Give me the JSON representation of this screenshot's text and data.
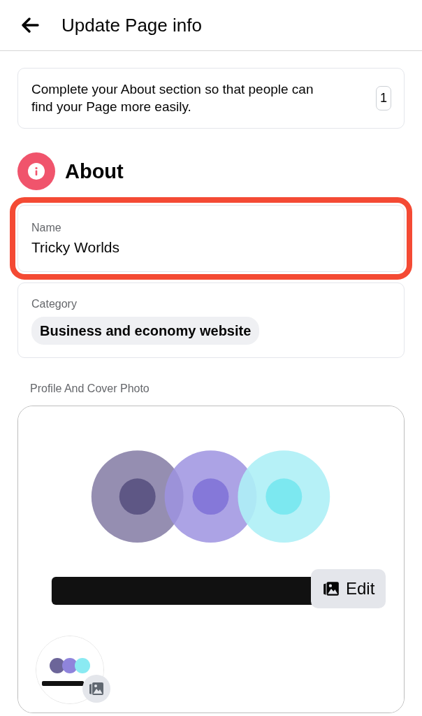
{
  "header": {
    "title": "Update Page info"
  },
  "notice": {
    "text": "Complete your About section so that people can find your Page more easily.",
    "count": "1"
  },
  "section": {
    "title": "About"
  },
  "fields": [
    {
      "kind": "text",
      "label": "Name",
      "value": "Tricky Worlds",
      "highlighted": true
    },
    {
      "kind": "chip",
      "label": "Category",
      "value": "Business and economy website",
      "highlighted": false
    }
  ],
  "photos": {
    "label": "Profile And Cover Photo",
    "edit_button": "Edit"
  }
}
